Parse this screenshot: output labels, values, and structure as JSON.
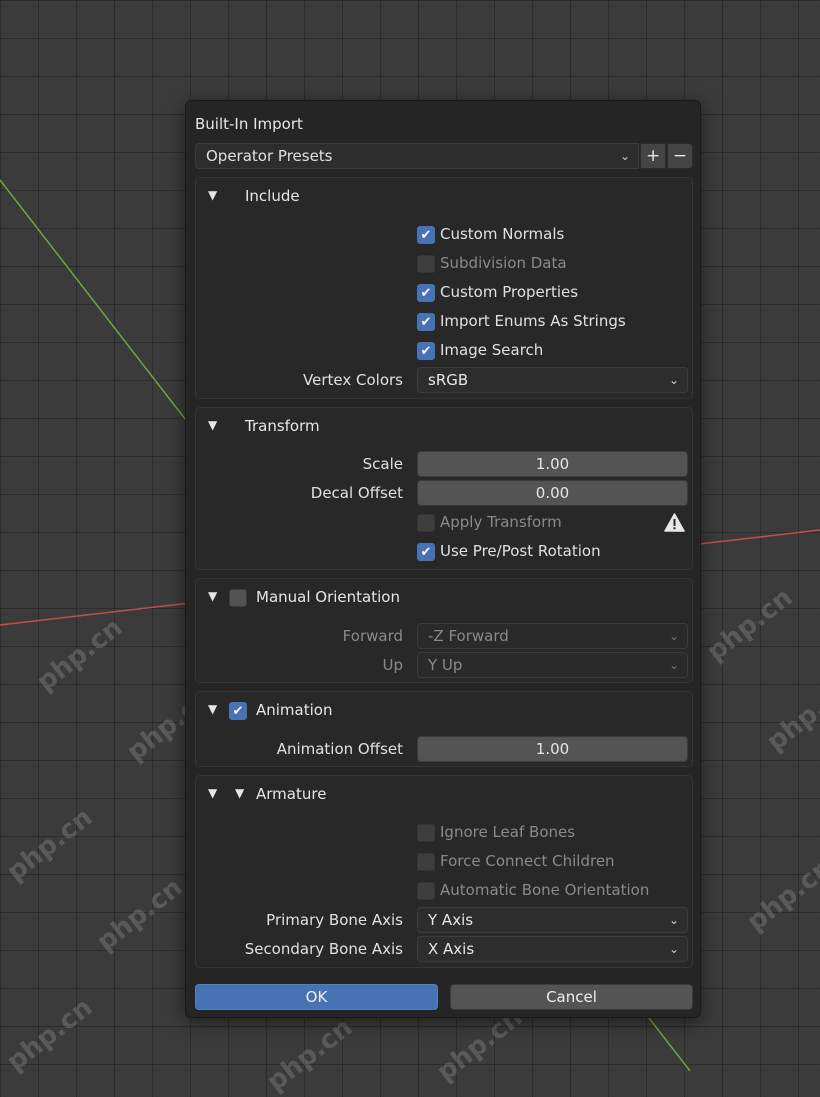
{
  "dialog": {
    "title": "Built-In Import",
    "preset": {
      "label": "Operator Presets",
      "add_symbol": "+",
      "remove_symbol": "−"
    },
    "include": {
      "title": "Include",
      "options": [
        {
          "label": "Custom Normals",
          "checked": true,
          "enabled": true
        },
        {
          "label": "Subdivision Data",
          "checked": false,
          "enabled": false
        },
        {
          "label": "Custom Properties",
          "checked": true,
          "enabled": true
        },
        {
          "label": "Import Enums As Strings",
          "checked": true,
          "enabled": true
        },
        {
          "label": "Image Search",
          "checked": true,
          "enabled": true
        }
      ],
      "vertex_colors_label": "Vertex Colors",
      "vertex_colors_value": "sRGB"
    },
    "transform": {
      "title": "Transform",
      "scale_label": "Scale",
      "scale_value": "1.00",
      "decal_offset_label": "Decal Offset",
      "decal_offset_value": "0.00",
      "apply_transform_label": "Apply Transform",
      "apply_transform_checked": false,
      "use_pre_post_label": "Use Pre/Post Rotation",
      "use_pre_post_checked": true
    },
    "manual_orientation": {
      "title": "Manual Orientation",
      "checked": false,
      "forward_label": "Forward",
      "forward_value": "-Z Forward",
      "up_label": "Up",
      "up_value": "Y Up"
    },
    "animation": {
      "title": "Animation",
      "checked": true,
      "offset_label": "Animation Offset",
      "offset_value": "1.00"
    },
    "armature": {
      "title": "Armature",
      "options": [
        {
          "label": "Ignore Leaf Bones",
          "checked": false
        },
        {
          "label": "Force Connect Children",
          "checked": false
        },
        {
          "label": "Automatic Bone Orientation",
          "checked": false
        }
      ],
      "primary_axis_label": "Primary Bone Axis",
      "primary_axis_value": "Y Axis",
      "secondary_axis_label": "Secondary Bone Axis",
      "secondary_axis_value": "X Axis"
    },
    "ok_label": "OK",
    "cancel_label": "Cancel"
  },
  "watermark_text": "php.cn",
  "colors": {
    "accent": "#4772b3",
    "dialog_bg": "#252525",
    "viewport_bg": "#3b3b3b",
    "axis_x": "#c0504d",
    "axis_y": "#6fa53c"
  },
  "icons": {
    "collapse": "triangle-down-icon",
    "dropdown": "chevron-down-icon",
    "warning": "warning-icon",
    "check": "checkmark-icon"
  }
}
